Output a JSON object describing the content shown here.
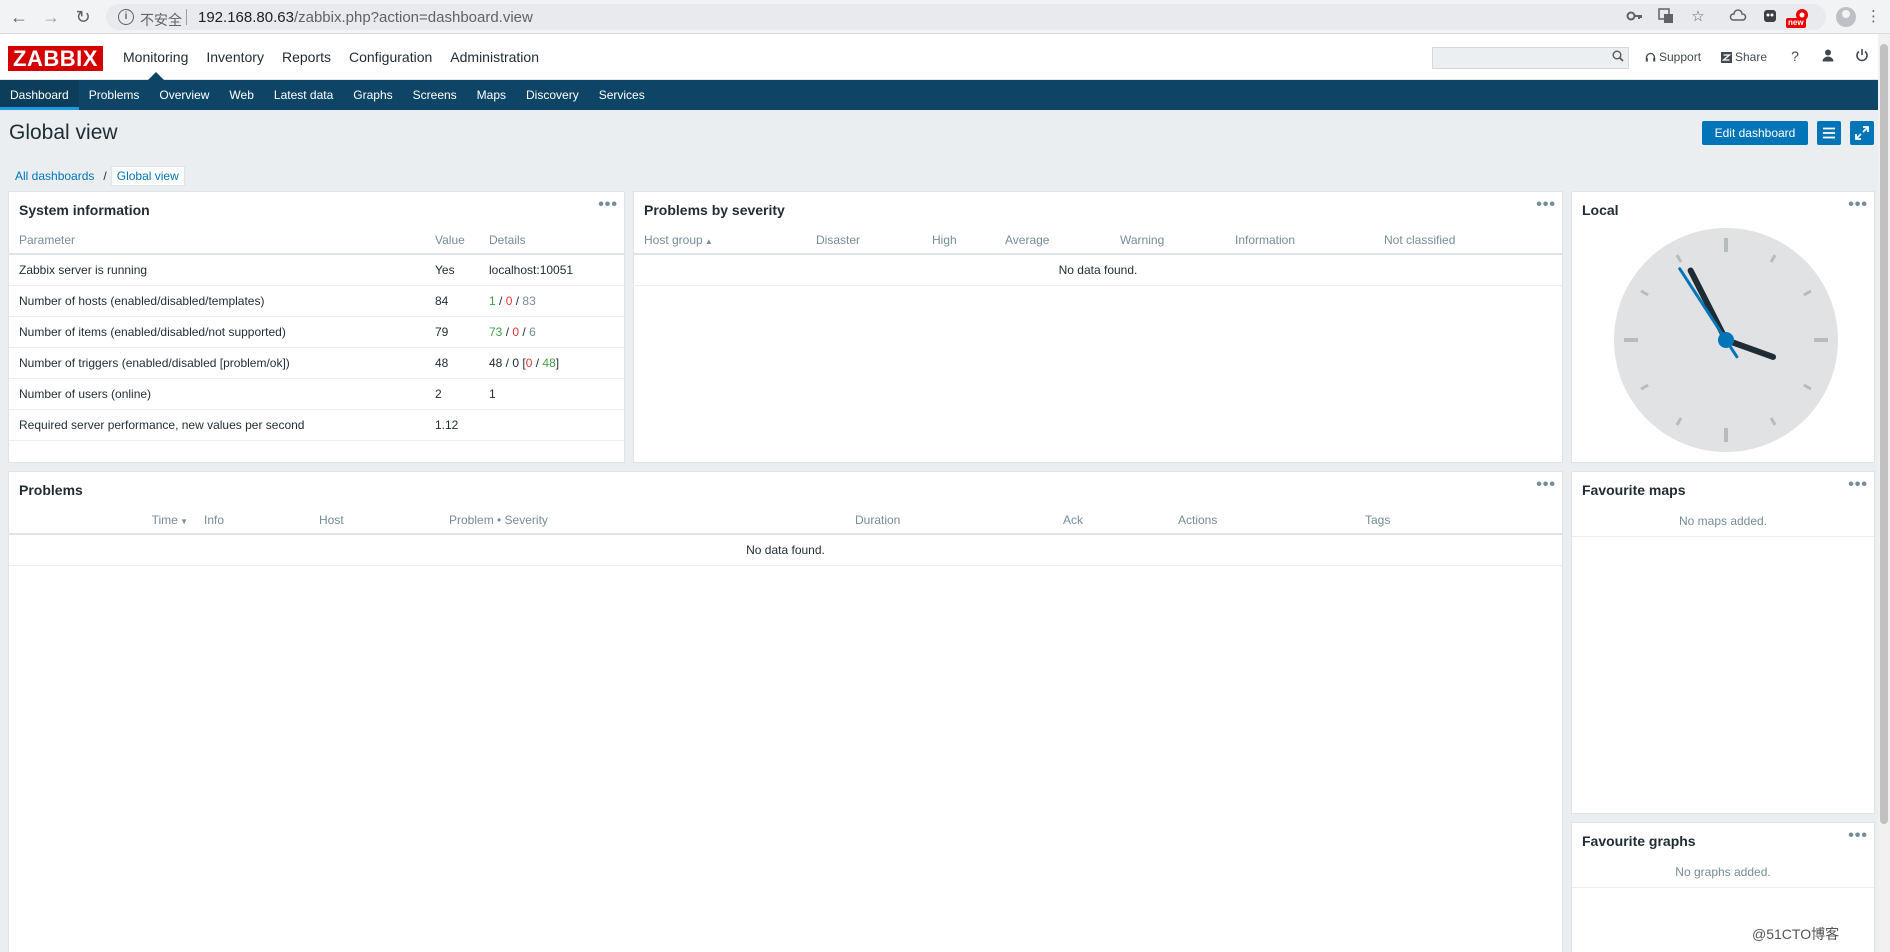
{
  "browser": {
    "insecure_label": "不安全",
    "url_host": "192.168.80.63",
    "url_path": "/zabbix.php?action=dashboard.view",
    "ext_badge": "new"
  },
  "header": {
    "logo": "ZABBIX",
    "menu": [
      "Monitoring",
      "Inventory",
      "Reports",
      "Configuration",
      "Administration"
    ],
    "support_label": "Support",
    "share_label": "Share",
    "help_label": "?"
  },
  "subnav": [
    "Dashboard",
    "Problems",
    "Overview",
    "Web",
    "Latest data",
    "Graphs",
    "Screens",
    "Maps",
    "Discovery",
    "Services"
  ],
  "page": {
    "title": "Global view",
    "edit_button": "Edit dashboard",
    "breadcrumb": [
      "All dashboards",
      "Global view"
    ],
    "breadcrumb_sep": "/"
  },
  "system_info": {
    "title": "System information",
    "menu": "•••",
    "columns": [
      "Parameter",
      "Value",
      "Details"
    ],
    "rows": [
      {
        "param": "Zabbix server is running",
        "value": "Yes",
        "details": "localhost:10051"
      },
      {
        "param": "Number of hosts (enabled/disabled/templates)",
        "value": "84",
        "d1": "1",
        "d2": "0",
        "d3": "83"
      },
      {
        "param": "Number of items (enabled/disabled/not supported)",
        "value": "79",
        "d1": "73",
        "d2": "0",
        "d3": "6"
      },
      {
        "param": "Number of triggers (enabled/disabled [problem/ok])",
        "value": "48",
        "d_prefix": "48 / 0 [",
        "d1": "0",
        "d2": "48",
        "d_suffix": "]"
      },
      {
        "param": "Number of users (online)",
        "value": "2",
        "details": "1"
      },
      {
        "param": "Required server performance, new values per second",
        "value": "1.12",
        "details": ""
      }
    ]
  },
  "severity": {
    "title": "Problems by severity",
    "menu": "•••",
    "columns": [
      "Host group",
      "Disaster",
      "High",
      "Average",
      "Warning",
      "Information",
      "Not classified"
    ],
    "empty": "No data found."
  },
  "local": {
    "title": "Local",
    "menu": "•••",
    "clock_hour": 3.66,
    "clock_minute": 55.5,
    "clock_second": 54.5
  },
  "problems": {
    "title": "Problems",
    "menu": "•••",
    "columns": [
      "Time",
      "Info",
      "Host",
      "Problem • Severity",
      "Duration",
      "Ack",
      "Actions",
      "Tags"
    ],
    "empty": "No data found."
  },
  "fav_maps": {
    "title": "Favourite maps",
    "menu": "•••",
    "empty": "No maps added."
  },
  "fav_graphs": {
    "title": "Favourite graphs",
    "menu": "•••",
    "empty": "No graphs added."
  },
  "watermark": "@51CTO博客",
  "colors": {
    "brand_red": "#d40000",
    "nav_blue": "#0e4566",
    "button_blue": "#0275b8",
    "ok_green": "#429e47",
    "problem_red": "#e33734"
  }
}
